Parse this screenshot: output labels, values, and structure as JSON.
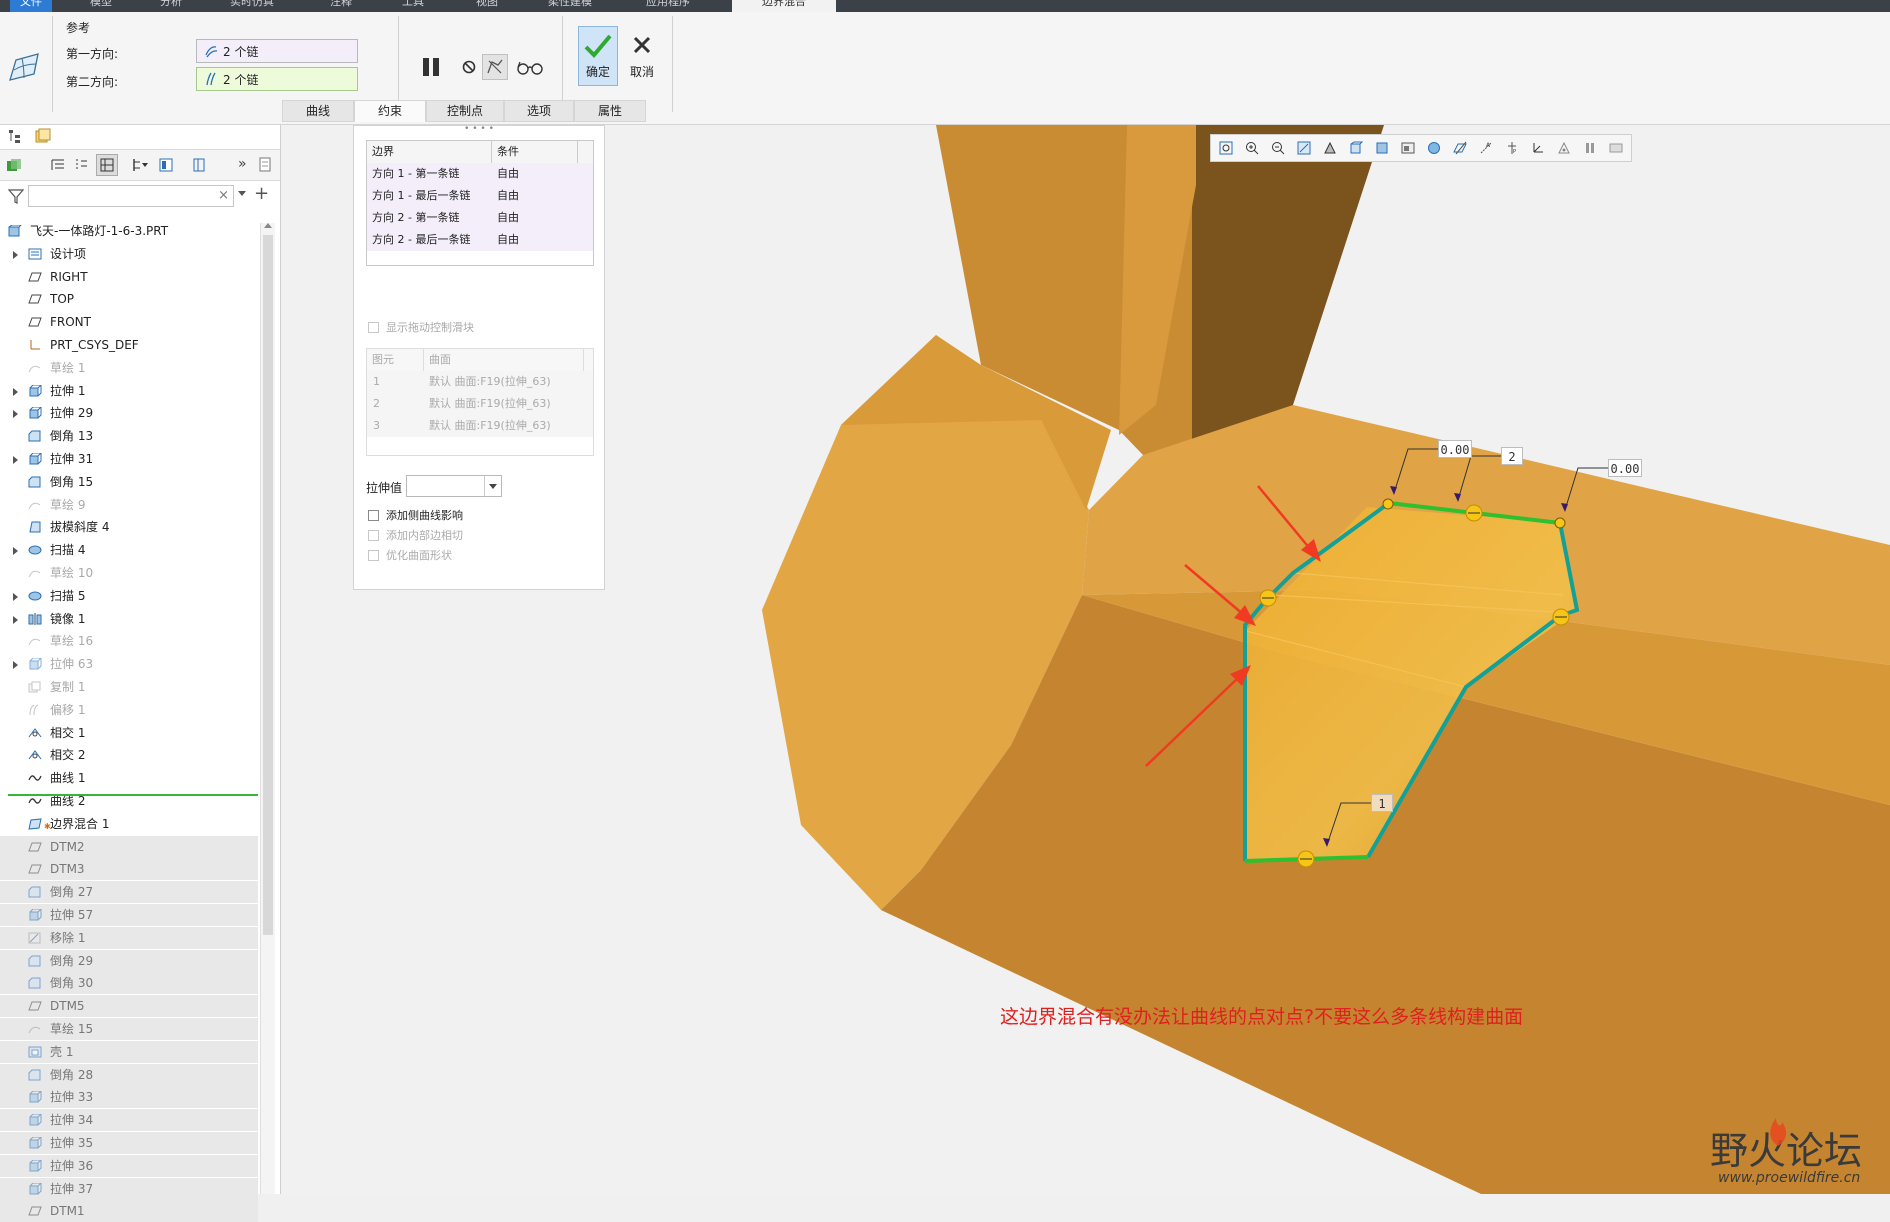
{
  "menu": {
    "items": [
      "文件",
      "模型",
      "分析",
      "实时仿真",
      "注释",
      "工具",
      "视图",
      "柔性建模",
      "应用程序",
      "边界混合"
    ],
    "active_index": 9
  },
  "dashboard": {
    "section_title": "参考",
    "first_direction_label": "第一方向:",
    "first_direction_value": "2 个链",
    "second_direction_label": "第二方向:",
    "second_direction_value": "2 个链",
    "confirm_label": "确定",
    "cancel_label": "取消",
    "tabs": [
      "曲线",
      "约束",
      "控制点",
      "选项",
      "属性"
    ],
    "active_tab_index": 1
  },
  "model_tree": {
    "search_placeholder": "",
    "items": [
      {
        "label": "飞天-一体路灯-1-6-3.PRT",
        "icon": "part-icon",
        "state": "normal",
        "expandable": false,
        "indent": 0
      },
      {
        "label": "设计项",
        "icon": "design-items-icon",
        "state": "normal",
        "expandable": true,
        "indent": 1
      },
      {
        "label": "RIGHT",
        "icon": "datum-plane-icon",
        "state": "normal",
        "expandable": false,
        "indent": 1
      },
      {
        "label": "TOP",
        "icon": "datum-plane-icon",
        "state": "normal",
        "expandable": false,
        "indent": 1
      },
      {
        "label": "FRONT",
        "icon": "datum-plane-icon",
        "state": "normal",
        "expandable": false,
        "indent": 1
      },
      {
        "label": "PRT_CSYS_DEF",
        "icon": "csys-icon",
        "state": "normal",
        "expandable": false,
        "indent": 1
      },
      {
        "label": "草绘 1",
        "icon": "sketch-icon",
        "state": "dim",
        "expandable": false,
        "indent": 1
      },
      {
        "label": "拉伸 1",
        "icon": "extrude-icon",
        "state": "normal",
        "expandable": true,
        "indent": 1
      },
      {
        "label": "拉伸 29",
        "icon": "extrude-icon",
        "state": "normal",
        "expandable": true,
        "indent": 1
      },
      {
        "label": "倒角 13",
        "icon": "chamfer-icon",
        "state": "normal",
        "expandable": false,
        "indent": 1
      },
      {
        "label": "拉伸 31",
        "icon": "extrude-icon",
        "state": "normal",
        "expandable": true,
        "indent": 1
      },
      {
        "label": "倒角 15",
        "icon": "chamfer-icon",
        "state": "normal",
        "expandable": false,
        "indent": 1
      },
      {
        "label": "草绘 9",
        "icon": "sketch-icon",
        "state": "dim",
        "expandable": false,
        "indent": 1
      },
      {
        "label": "拔模斜度 4",
        "icon": "draft-icon",
        "state": "normal",
        "expandable": false,
        "indent": 1
      },
      {
        "label": "扫描 4",
        "icon": "sweep-icon",
        "state": "normal",
        "expandable": true,
        "indent": 1
      },
      {
        "label": "草绘 10",
        "icon": "sketch-icon",
        "state": "dim",
        "expandable": false,
        "indent": 1
      },
      {
        "label": "扫描 5",
        "icon": "sweep-icon",
        "state": "normal",
        "expandable": true,
        "indent": 1
      },
      {
        "label": "镜像 1",
        "icon": "mirror-icon",
        "state": "normal",
        "expandable": true,
        "indent": 1
      },
      {
        "label": "草绘 16",
        "icon": "sketch-icon",
        "state": "dim",
        "expandable": false,
        "indent": 1
      },
      {
        "label": "拉伸 63",
        "icon": "extrude-icon",
        "state": "dim",
        "expandable": true,
        "indent": 1
      },
      {
        "label": "复制 1",
        "icon": "copy-icon",
        "state": "dim",
        "expandable": false,
        "indent": 1
      },
      {
        "label": "偏移 1",
        "icon": "offset-icon",
        "state": "dim",
        "expandable": false,
        "indent": 1
      },
      {
        "label": "相交 1",
        "icon": "intersect-icon",
        "state": "normal",
        "expandable": false,
        "indent": 1
      },
      {
        "label": "相交 2",
        "icon": "intersect-icon",
        "state": "normal",
        "expandable": false,
        "indent": 1
      },
      {
        "label": "曲线 1",
        "icon": "curve-icon",
        "state": "normal",
        "expandable": false,
        "indent": 1
      },
      {
        "label": "曲线 2",
        "icon": "curve-icon",
        "state": "normal",
        "expandable": false,
        "indent": 1
      },
      {
        "label": "边界混合 1",
        "icon": "boundary-blend-icon",
        "state": "current",
        "expandable": false,
        "indent": 1
      },
      {
        "label": "DTM2",
        "icon": "datum-plane-icon",
        "state": "after",
        "expandable": false,
        "indent": 1
      },
      {
        "label": "DTM3",
        "icon": "datum-plane-icon",
        "state": "after",
        "expandable": false,
        "indent": 1
      },
      {
        "label": "倒角 27",
        "icon": "chamfer-icon",
        "state": "after",
        "expandable": false,
        "indent": 1
      },
      {
        "label": "拉伸 57",
        "icon": "extrude-icon",
        "state": "after",
        "expandable": false,
        "indent": 1
      },
      {
        "label": "移除 1",
        "icon": "remove-icon",
        "state": "after",
        "expandable": false,
        "indent": 1
      },
      {
        "label": "倒角 29",
        "icon": "chamfer-icon",
        "state": "after",
        "expandable": false,
        "indent": 1
      },
      {
        "label": "倒角 30",
        "icon": "chamfer-icon",
        "state": "after",
        "expandable": false,
        "indent": 1
      },
      {
        "label": "DTM5",
        "icon": "datum-plane-icon",
        "state": "after",
        "expandable": false,
        "indent": 1
      },
      {
        "label": "草绘 15",
        "icon": "sketch-icon",
        "state": "after",
        "expandable": false,
        "indent": 1
      },
      {
        "label": "壳 1",
        "icon": "shell-icon",
        "state": "after",
        "expandable": false,
        "indent": 1
      },
      {
        "label": "倒角 28",
        "icon": "chamfer-icon",
        "state": "after",
        "expandable": false,
        "indent": 1
      },
      {
        "label": "拉伸 33",
        "icon": "extrude-icon",
        "state": "after",
        "expandable": false,
        "indent": 1
      },
      {
        "label": "拉伸 34",
        "icon": "extrude-icon",
        "state": "after",
        "expandable": false,
        "indent": 1
      },
      {
        "label": "拉伸 35",
        "icon": "extrude-icon",
        "state": "after",
        "expandable": false,
        "indent": 1
      },
      {
        "label": "拉伸 36",
        "icon": "extrude-icon",
        "state": "after",
        "expandable": false,
        "indent": 1
      },
      {
        "label": "拉伸 37",
        "icon": "extrude-icon",
        "state": "after",
        "expandable": false,
        "indent": 1
      },
      {
        "label": "DTM1",
        "icon": "datum-plane-icon",
        "state": "after",
        "expandable": false,
        "indent": 1
      }
    ]
  },
  "constraints_panel": {
    "table1_headers": [
      "边界",
      "条件"
    ],
    "table1_rows": [
      [
        "方向 1 - 第一条链",
        "自由"
      ],
      [
        "方向 1 - 最后一条链",
        "自由"
      ],
      [
        "方向 2 - 第一条链",
        "自由"
      ],
      [
        "方向 2 - 最后一条链",
        "自由"
      ]
    ],
    "show_drag_handles_label": "显示拖动控制滑块",
    "table2_headers": [
      "图元",
      "曲面"
    ],
    "table2_rows": [
      [
        "1",
        "默认 曲面:F19(拉伸_63)"
      ],
      [
        "2",
        "默认 曲面:F19(拉伸_63)"
      ],
      [
        "3",
        "默认 曲面:F19(拉伸_63)"
      ]
    ],
    "stretch_label": "拉伸值",
    "stretch_value": "",
    "add_side_curve_label": "添加侧曲线影响",
    "add_inner_edge_label": "添加内部边相切",
    "optimize_surface_label": "优化曲面形状"
  },
  "viewport": {
    "dim_labels": [
      "0.00",
      "2",
      "0.00",
      "1"
    ],
    "question_text": "这边界混合有没办法让曲线的点对点?不要这么多条线构建曲面",
    "colors": {
      "solid_light": "#e0a040",
      "solid_dark": "#7a5520",
      "blend_surface": "#eba52a",
      "chain_teal": "#13a096",
      "chain_green": "#2fbf2f",
      "arrow_red": "#f03a22",
      "handle_yellow": "#f5c518"
    }
  },
  "watermark": {
    "text": "野火论坛",
    "url": "www.proewildfire.cn"
  }
}
